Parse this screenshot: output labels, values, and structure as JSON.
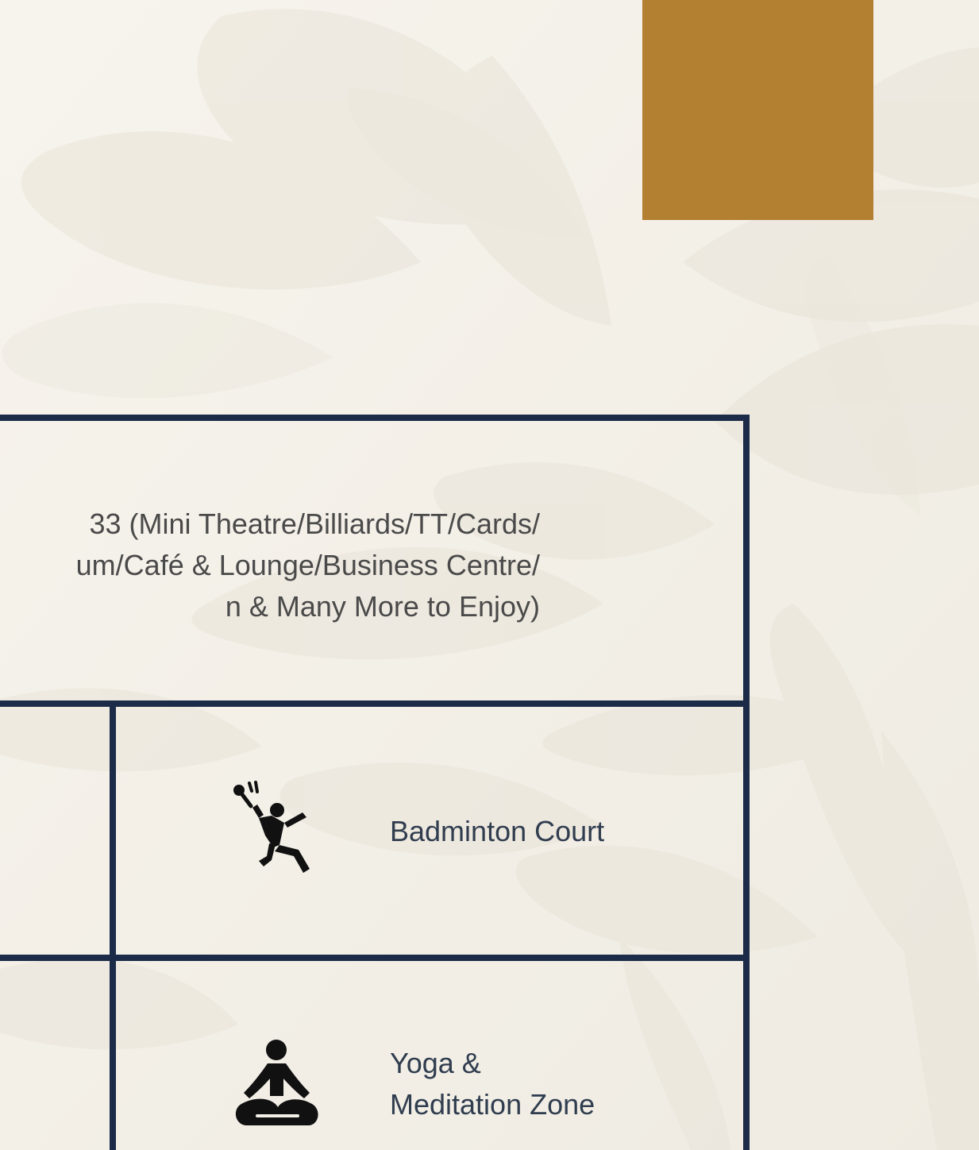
{
  "colors": {
    "background": "#f3f0e8",
    "accent": "#b37f31",
    "border": "#1b2b48",
    "text": "#4a4a4a",
    "amenity_text": "#303d4f"
  },
  "clubhouse": {
    "lines": [
      "33 (Mini Theatre/Billiards/TT/Cards/",
      "um/Café & Lounge/Business Centre/",
      "n & Many More to Enjoy)"
    ]
  },
  "amenities": [
    {
      "label": "Badminton Court",
      "icon": "badminton-icon"
    },
    {
      "label_lines": [
        "Yoga &",
        "Meditation Zone"
      ],
      "icon": "yoga-meditation-icon"
    }
  ]
}
